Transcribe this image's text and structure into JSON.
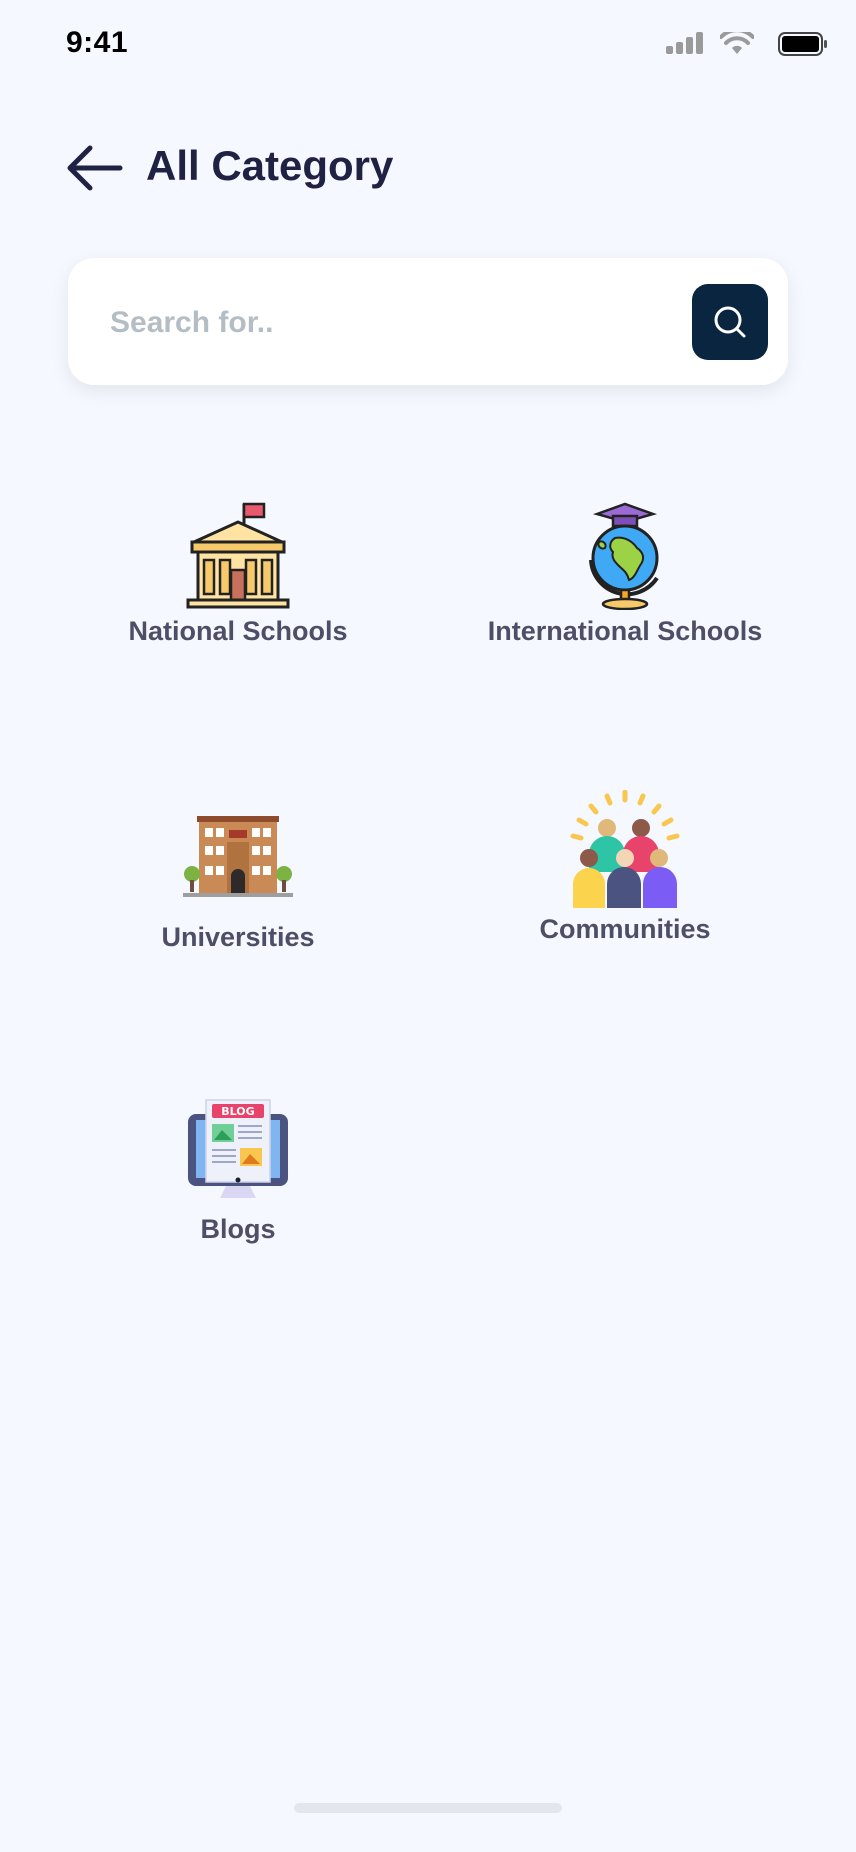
{
  "status_bar": {
    "time": "9:41"
  },
  "header": {
    "title": "All Category"
  },
  "search": {
    "placeholder": "Search for.."
  },
  "categories": [
    {
      "label": "National Schools",
      "icon": "school-building-icon"
    },
    {
      "label": "International Schools",
      "icon": "globe-graduation-icon"
    },
    {
      "label": "Universities",
      "icon": "university-building-icon"
    },
    {
      "label": "Communities",
      "icon": "community-people-icon"
    },
    {
      "label": "Blogs",
      "icon": "blog-monitor-icon"
    }
  ],
  "colors": {
    "background": "#F5F8FE",
    "title": "#202244",
    "search_button": "#0A2540",
    "placeholder": "#B4BDC4",
    "label": "#4C4F66"
  }
}
